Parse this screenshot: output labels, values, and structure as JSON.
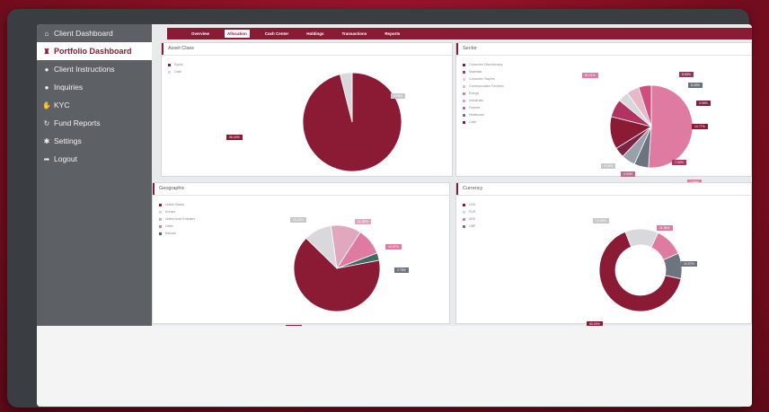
{
  "sidebar": {
    "items": [
      {
        "label": "Client Dashboard",
        "icon": "house-icon",
        "glyph": "⌂",
        "active": false
      },
      {
        "label": "Portfolio Dashboard",
        "icon": "bank-icon",
        "glyph": "♜",
        "active": true
      },
      {
        "label": "Client Instructions",
        "icon": "instructions-icon",
        "glyph": "●",
        "active": false
      },
      {
        "label": "Inquiries",
        "icon": "chat-bubble-icon",
        "glyph": "●",
        "active": false
      },
      {
        "label": "KYC",
        "icon": "handshake-icon",
        "glyph": "✋",
        "active": false
      },
      {
        "label": "Fund Reports",
        "icon": "refresh-icon",
        "glyph": "↻",
        "active": false
      },
      {
        "label": "Settings",
        "icon": "gear-icon",
        "glyph": "✱",
        "active": false
      },
      {
        "label": "Logout",
        "icon": "logout-icon",
        "glyph": "➦",
        "active": false
      }
    ]
  },
  "tabs": [
    {
      "label": "Overview",
      "active": false
    },
    {
      "label": "Allocation",
      "active": true
    },
    {
      "label": "Cash Center",
      "active": false
    },
    {
      "label": "Holdings",
      "active": false
    },
    {
      "label": "Transactions",
      "active": false
    },
    {
      "label": "Reports",
      "active": false
    }
  ],
  "colors": {
    "accent": "#8b1a35",
    "sidebar": "#5d6165"
  },
  "panels": [
    {
      "key": "asset_class",
      "title": "Asset Class",
      "legend": [
        {
          "label": "Equity",
          "color": "#8b1a35"
        },
        {
          "label": "Cash",
          "color": "#d9d9dd"
        }
      ],
      "chart_data": {
        "type": "pie",
        "donut": false,
        "slices": [
          {
            "label": "Equity",
            "value": 96.04,
            "color": "#8b1a35"
          },
          {
            "label": "Cash",
            "value": 3.96,
            "color": "#d9d9dd"
          }
        ]
      },
      "labels": [
        {
          "text": "96.04%",
          "color": "#8b1a35"
        },
        {
          "text": "3.96%",
          "color": "#c8c8cc"
        }
      ]
    },
    {
      "key": "sector",
      "title": "Sector",
      "legend": [
        {
          "label": "Consumer Discretionary",
          "color": "#8b1a35"
        },
        {
          "label": "Materials",
          "color": "#b03361"
        },
        {
          "label": "Consumer Staples",
          "color": "#d4d4d8"
        },
        {
          "label": "Communication Services",
          "color": "#e8b8c9"
        },
        {
          "label": "Energy",
          "color": "#df7ba0"
        },
        {
          "label": "Industrials",
          "color": "#e9a2bd"
        },
        {
          "label": "Finance",
          "color": "#c26a8a"
        },
        {
          "label": "Healthcare",
          "color": "#6d7480"
        },
        {
          "label": "Cash",
          "color": "#8b1a35"
        }
      ],
      "chart_data": {
        "type": "pie",
        "donut": false,
        "slices": [
          {
            "label": "Communication Services",
            "value": 51.11,
            "color": "#df7ba0"
          },
          {
            "label": "Healthcare",
            "value": 5.65,
            "color": "#6d7480"
          },
          {
            "label": "Industrials",
            "value": 5.43,
            "color": "#9aa0aa"
          },
          {
            "label": "Consumer Discretionary",
            "value": 3.95,
            "color": "#7d2240"
          },
          {
            "label": "Materials",
            "value": 12.77,
            "color": "#8b1a35"
          },
          {
            "label": "Finance",
            "value": 7.02,
            "color": "#b03361"
          },
          {
            "label": "Consumer Staples",
            "value": 4.18,
            "color": "#d8d8dc"
          },
          {
            "label": "Energy",
            "value": 4.94,
            "color": "#e8b8c9"
          },
          {
            "label": "Cash",
            "value": 4.96,
            "color": "#d14d80"
          }
        ]
      },
      "labels": [
        {
          "text": "51.11%",
          "color": "#df7ba0"
        },
        {
          "text": "5.65%",
          "color": "#8b3a5a"
        },
        {
          "text": "5.43%",
          "color": "#6d7480"
        },
        {
          "text": "3.95%",
          "color": "#7d2240"
        },
        {
          "text": "12.77%",
          "color": "#8b1a35"
        },
        {
          "text": "7.02%",
          "color": "#b03361"
        },
        {
          "text": "4.18%",
          "color": "#c8c8cc"
        },
        {
          "text": "4.94%",
          "color": "#c26a8a"
        },
        {
          "text": "4.96%",
          "color": "#df7ba0"
        }
      ]
    },
    {
      "key": "geographic",
      "title": "Geographic",
      "legend": [
        {
          "label": "United States",
          "color": "#8b1a35"
        },
        {
          "label": "Europe",
          "color": "#d9d9dd"
        },
        {
          "label": "United Arab Emirates",
          "color": "#e0a7bd"
        },
        {
          "label": "Other",
          "color": "#df7ba0"
        },
        {
          "label": "Bahrain",
          "color": "#3f6b63"
        }
      ],
      "chart_data": {
        "type": "pie",
        "donut": false,
        "slices": [
          {
            "label": "United Arab Emirates",
            "value": 11.35,
            "color": "#e0a7bd"
          },
          {
            "label": "Other",
            "value": 10.07,
            "color": "#df7ba0"
          },
          {
            "label": "Bahrain",
            "value": 2.78,
            "color": "#3f6b63"
          },
          {
            "label": "United States",
            "value": 65.38,
            "color": "#8b1a35"
          },
          {
            "label": "Europe",
            "value": 10.42,
            "color": "#d9d9dd"
          }
        ]
      },
      "labels": [
        {
          "text": "11.35%",
          "color": "#e0a7bd"
        },
        {
          "text": "10.07%",
          "color": "#df7ba0"
        },
        {
          "text": "2.78%",
          "color": "#6d7480"
        },
        {
          "text": "65.38%",
          "color": "#8b1a35"
        },
        {
          "text": "10.42%",
          "color": "#c8c8cc"
        }
      ]
    },
    {
      "key": "currency",
      "title": "Currency",
      "legend": [
        {
          "label": "USD",
          "color": "#8b1a35"
        },
        {
          "label": "EUR",
          "color": "#d9d9dd"
        },
        {
          "label": "AED",
          "color": "#df7ba0"
        },
        {
          "label": "GBP",
          "color": "#6d7480"
        }
      ],
      "chart_data": {
        "type": "pie",
        "donut": true,
        "slices": [
          {
            "label": "AED",
            "value": 11.36,
            "color": "#df7ba0"
          },
          {
            "label": "GBP",
            "value": 10.07,
            "color": "#6d7480"
          },
          {
            "label": "USD",
            "value": 65.59,
            "color": "#8b1a35"
          },
          {
            "label": "EUR",
            "value": 12.98,
            "color": "#d9d9dd"
          }
        ]
      },
      "labels": [
        {
          "text": "11.36%",
          "color": "#df7ba0"
        },
        {
          "text": "10.07%",
          "color": "#6d7480"
        },
        {
          "text": "65.59%",
          "color": "#8b1a35"
        },
        {
          "text": "12.98%",
          "color": "#c8c8cc"
        }
      ]
    }
  ]
}
